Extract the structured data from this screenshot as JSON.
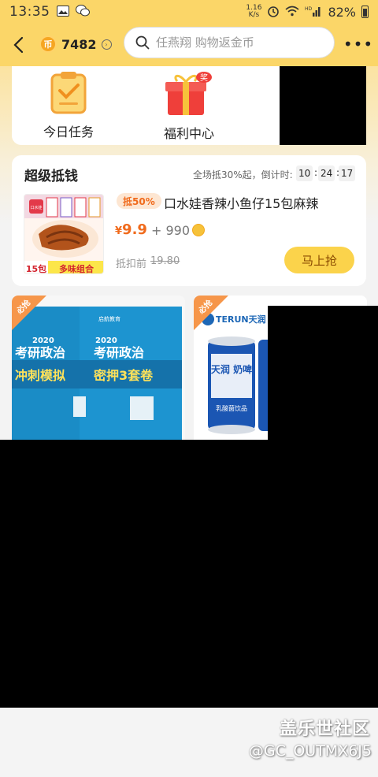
{
  "status_bar": {
    "time": "13:35",
    "network_speed": "1.16\nK/s",
    "battery": "82%"
  },
  "header": {
    "coin_count": "7482",
    "coin_symbol": "币",
    "search_placeholder": "任燕翔 购物返金币",
    "more": "•••"
  },
  "features": [
    {
      "label": "今日任务",
      "icon": "clipboard-check-icon"
    },
    {
      "label": "福利中心",
      "icon": "gift-box-icon",
      "badge": "奖"
    }
  ],
  "deal": {
    "title": "超级抵钱",
    "countdown_text": "全场抵30%起，倒计时:",
    "countdown": [
      "10",
      "24",
      "17"
    ],
    "discount_badge": "抵50%",
    "product_name": "口水娃香辣小鱼仔15包麻辣",
    "price_symbol": "¥",
    "price": "9.9",
    "plus_coins": "+ 990",
    "before_label": "抵扣前",
    "before_price": "19.80",
    "grab_button": "马上抢",
    "image_text": {
      "brand": "口水娃",
      "count": "15包",
      "combo": "多味组合"
    }
  },
  "tiles": [
    {
      "badge": "必抢",
      "book_line1": "2020",
      "book_line2": "考研政治",
      "book_line3": "冲刺模拟",
      "book2_line3": "密押3套卷",
      "brand": "启航教育"
    },
    {
      "badge": "必抢",
      "brand": "TERUN天润",
      "can_text": "天润 奶啤",
      "can_sub": "乳酸菌饮品"
    }
  ],
  "watermark": {
    "brand": "盖乐世社区",
    "user": "@GC_OUTMX6J5"
  },
  "colors": {
    "header_yellow": "#fbd668",
    "accent_orange": "#f06b1d",
    "button_yellow": "#fbd34b"
  }
}
